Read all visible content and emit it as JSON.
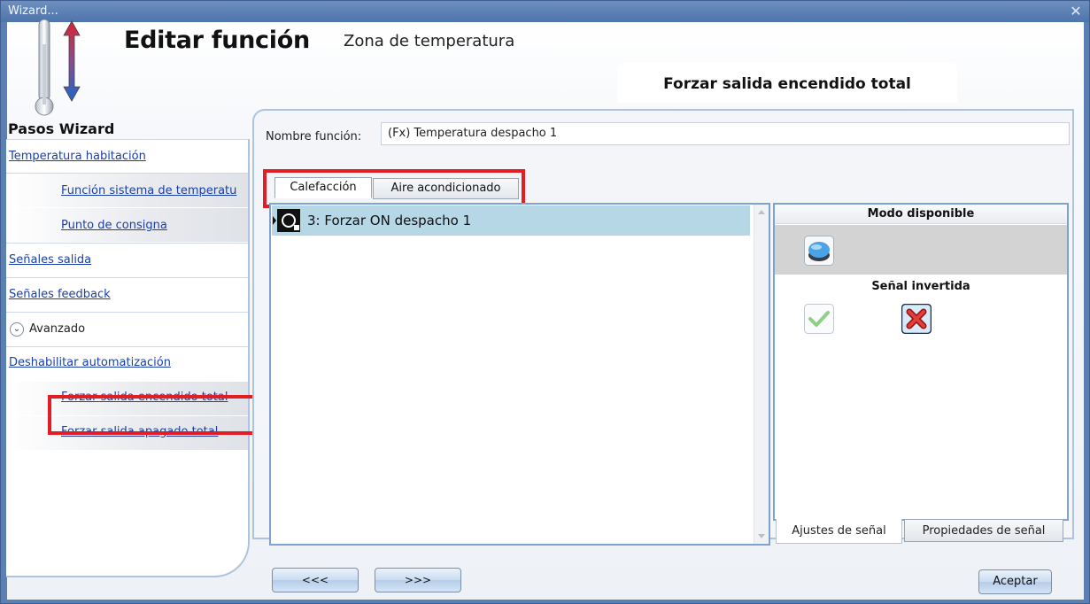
{
  "window": {
    "title": "Wizard...",
    "close_glyph": "✕"
  },
  "header": {
    "title": "Editar función",
    "subtitle": "Zona de temperatura",
    "current_step": "Forzar salida encendido total",
    "icon": "thermometer-icon"
  },
  "steps": {
    "title": "Pasos Wizard",
    "items": [
      {
        "label": "Temperatura habitación"
      },
      {
        "label": "Función sistema de temperatu"
      },
      {
        "label": "Punto de consigna"
      },
      {
        "label": "Señales salida"
      },
      {
        "label": "Señales feedback"
      },
      {
        "label": "Deshabilitar automatización"
      },
      {
        "label": "Forzar salida encendido total"
      },
      {
        "label": "Forzar salida apagado total"
      }
    ],
    "advanced_label": "Avanzado",
    "advanced_glyph": "⌄"
  },
  "main": {
    "name_label": "Nombre función:",
    "name_value": "(Fx) Temperatura despacho 1",
    "tabs": [
      {
        "label": "Calefacción",
        "active": true
      },
      {
        "label": "Aire acondicionado",
        "active": false
      }
    ],
    "list": [
      {
        "label": "3: Forzar ON despacho 1",
        "selected": true
      }
    ]
  },
  "properties": {
    "mode_header": "Modo disponible",
    "inverted_header": "Señal invertida",
    "tabs": [
      {
        "label": "Ajustes de señal",
        "active": true
      },
      {
        "label": "Propiedades de señal",
        "active": false
      }
    ]
  },
  "footer": {
    "back_label": "<<<",
    "next_label": ">>>",
    "accept_label": "Aceptar"
  },
  "colors": {
    "titlebar": "#5a7fb3",
    "highlight": "#e31d24",
    "selected_row": "#b6d7e6",
    "link": "#1a3fa8"
  }
}
